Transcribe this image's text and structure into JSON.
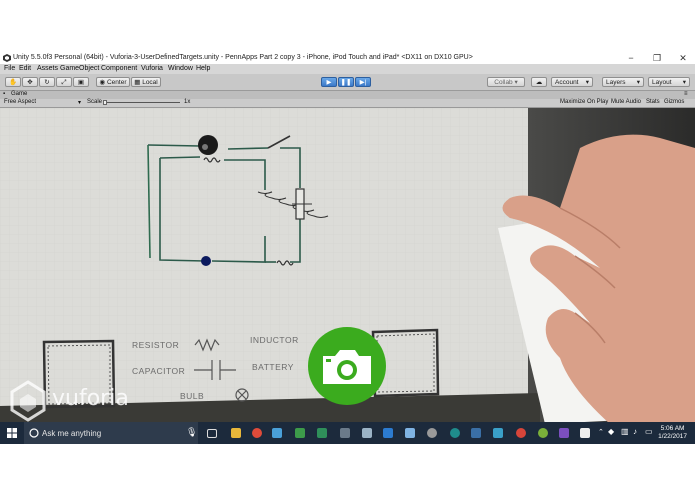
{
  "window": {
    "title": "Unity 5.5.0f3 Personal (64bit) - Vuforia-3-UserDefinedTargets.unity - PennApps Part 2 copy 3 - iPhone, iPod Touch and iPad* <DX11 on DX10 GPU>",
    "minimize": "−",
    "maximize": "❐",
    "close": "✕"
  },
  "menu": [
    "File",
    "Edit",
    "Assets",
    "GameObject",
    "Component",
    "Vuforia",
    "Window",
    "Help"
  ],
  "toolbar": {
    "pivot": "Center",
    "space": "Local",
    "collab": "Collab ▾",
    "account": "Account",
    "layers": "Layers",
    "layout": "Layout"
  },
  "game": {
    "tab": "Game",
    "aspect": "Free Aspect",
    "scale_label": "Scale",
    "scale_value": "1x",
    "maximize": "Maximize On Play",
    "mute": "Mute Audio",
    "stats": "Stats",
    "gizmos": "Gizmos"
  },
  "scene": {
    "legend": {
      "resistor": "RESISTOR",
      "inductor": "INDUCTOR",
      "capacitor": "CAPACITOR",
      "battery": "BATTERY",
      "bulb": "BULB"
    },
    "watermark": "vuforia",
    "camera_button_color": "#3bab1e"
  },
  "taskbar": {
    "search_placeholder": "Ask me anything",
    "time": "5:06 AM",
    "date": "1/22/2017"
  },
  "colors": {
    "taskbar": "#1c2a3c",
    "accent": "#3b79c9"
  }
}
